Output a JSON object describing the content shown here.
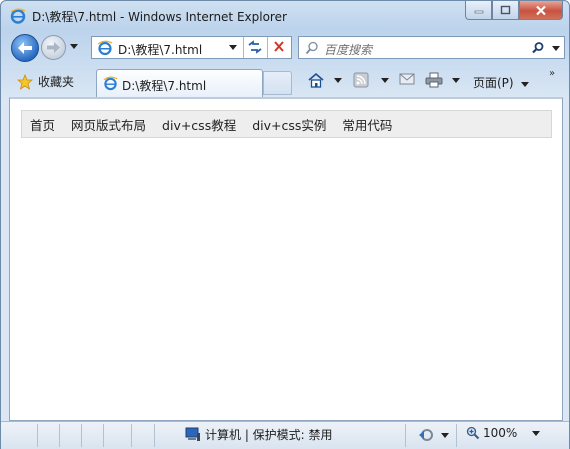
{
  "window": {
    "title": "D:\\教程\\7.html - Windows Internet Explorer"
  },
  "address_bar": {
    "url": "D:\\教程\\7.html"
  },
  "search_box": {
    "placeholder": "百度搜索"
  },
  "command_bar": {
    "favorites_label": "收藏夹",
    "tab_title": "D:\\教程\\7.html",
    "page_menu_label": "页面(P)"
  },
  "page": {
    "nav_items": [
      {
        "label": "首页"
      },
      {
        "label": "网页版式布局"
      },
      {
        "label": "div+css教程"
      },
      {
        "label": "div+css实例"
      },
      {
        "label": "常用代码"
      }
    ]
  },
  "status_bar": {
    "zone_text": "计算机 | 保护模式: 禁用",
    "zoom": "100%"
  },
  "colors": {
    "frame": "#bcd3ec",
    "close_button": "#c75340",
    "menu_background": "#eeeeee",
    "ie_icon": "#2a7fd4"
  }
}
